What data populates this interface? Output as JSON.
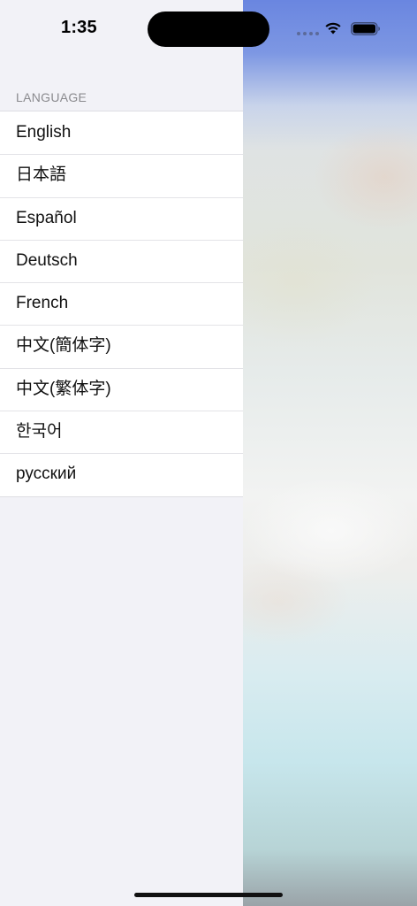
{
  "status_bar": {
    "time": "1:35",
    "icons": [
      "cellular-signal-icon",
      "wifi-icon",
      "battery-icon"
    ]
  },
  "language_section": {
    "header": "LANGUAGE",
    "options": [
      {
        "label": "English"
      },
      {
        "label": "日本語"
      },
      {
        "label": "Español"
      },
      {
        "label": "Deutsch"
      },
      {
        "label": "French"
      },
      {
        "label": "中文(簡体字)"
      },
      {
        "label": "中文(繁体字)"
      },
      {
        "label": "한국어"
      },
      {
        "label": "русский"
      }
    ]
  },
  "colors": {
    "panel_background": "#f2f2f7",
    "row_background": "#ffffff",
    "header_text": "#8a8a8e",
    "row_text": "#111111"
  }
}
